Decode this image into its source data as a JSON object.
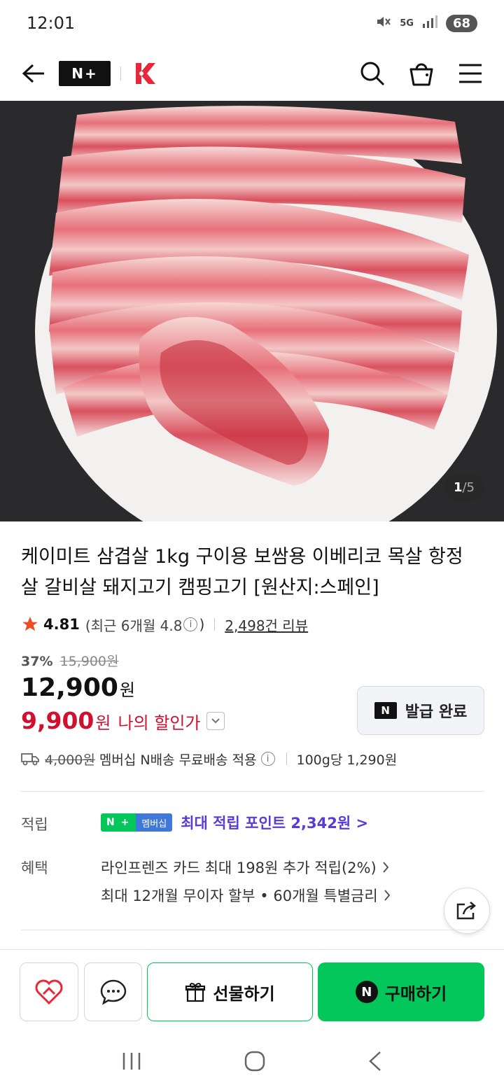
{
  "status": {
    "time": "12:01",
    "network": "5G",
    "battery": "68"
  },
  "header": {
    "logo_text": "N+"
  },
  "gallery": {
    "current": "1",
    "total": "/5"
  },
  "product": {
    "title": "케이미트 삼겹살 1kg 구이용 보쌈용 이베리코 목살 항정살 갈비살 돼지고기 캠핑고기 [원산지:스페인]",
    "rating": "4.81",
    "recent_rating_prefix": "(최근 6개월 4.8",
    "recent_rating_suffix": ")",
    "review_count": "2,498건 리뷰",
    "discount_pct": "37%",
    "original_price": "15,900원",
    "price_value": "12,900",
    "price_unit": "원",
    "my_price_value": "9,900",
    "my_price_unit": "원",
    "my_price_label": "나의 할인가"
  },
  "coupon": {
    "badge": "N",
    "label": "발급 완료"
  },
  "delivery": {
    "orig_fee": "4,000원",
    "text": "멤버십 N배송 무료배송 적용",
    "unit_price": "100g당 1,290원"
  },
  "points": {
    "label": "적립",
    "badge_left": "N +",
    "badge_right": "멤버십",
    "text": "최대 적립 포인트 2,342원 >"
  },
  "benefits": {
    "label": "혜택",
    "line1": "라인프렌즈 카드 최대 198원 추가 적립(2%)",
    "line2": "최대 12개월 무이자 할부 • 60개월 특별금리"
  },
  "bottom": {
    "gift_label": "선물하기",
    "buy_label": "구매하기",
    "buy_badge": "N"
  },
  "colors": {
    "naver_green": "#03c75a",
    "price_red": "#d1102e",
    "point_purple": "#5a3bd6"
  }
}
